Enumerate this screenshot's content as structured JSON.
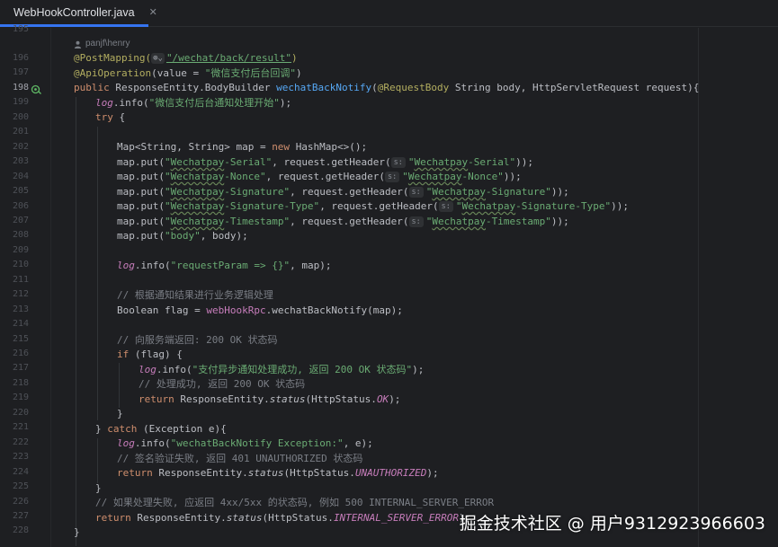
{
  "tab": {
    "label": "WebHookController.java",
    "close": "✕",
    "icon": "java-class-icon"
  },
  "author": "panjf\\henry",
  "gutter": {
    "first_partial": "195",
    "lines": [
      "196",
      "197",
      "198",
      "199",
      "200",
      "201",
      "202",
      "203",
      "204",
      "205",
      "206",
      "207",
      "208",
      "209",
      "210",
      "211",
      "212",
      "213",
      "214",
      "215",
      "216",
      "217",
      "218",
      "219",
      "220",
      "221",
      "222",
      "223",
      "224",
      "225",
      "226",
      "227",
      "228"
    ]
  },
  "code": {
    "l196": {
      "a": "@PostMapping(",
      "b": "\"/wechat/back/result\"",
      "c": ")"
    },
    "l197": {
      "a": "@ApiOperation",
      "b": "(value = ",
      "c": "\"微信支付后台回调\"",
      "d": ")"
    },
    "l198": {
      "a": "public ",
      "b": "ResponseEntity.BodyBuilder ",
      "c": "wechatBackNotify",
      "d": "(",
      "e": "@RequestBody ",
      "f": "String body, HttpServletRequest request){"
    },
    "l199": {
      "a": "log",
      "b": ".info(",
      "c": "\"微信支付后台通知处理开始\"",
      "d": ");"
    },
    "l200": {
      "a": "try",
      "b": " {"
    },
    "l202": {
      "a": "Map<String, String> map = ",
      "b": "new ",
      "c": "HashMap<>();"
    },
    "l203": {
      "a": "map.put(",
      "b": "\"",
      "c": "Wechatpay",
      "d": "-Serial\"",
      "e": ", request.getHeader(",
      "h": "s:",
      "f": "\"",
      "g": "Wechatpay",
      "i": "-Serial\"",
      "j": "));"
    },
    "l204": {
      "a": "map.put(",
      "b": "\"",
      "c": "Wechatpay",
      "d": "-Nonce\"",
      "e": ", request.getHeader(",
      "h": "s:",
      "f": "\"",
      "g": "Wechatpay",
      "i": "-Nonce\"",
      "j": "));"
    },
    "l205": {
      "a": "map.put(",
      "b": "\"",
      "c": "Wechatpay",
      "d": "-Signature\"",
      "e": ", request.getHeader(",
      "h": "s:",
      "f": "\"",
      "g": "Wechatpay",
      "i": "-Signature\"",
      "j": "));"
    },
    "l206": {
      "a": "map.put(",
      "b": "\"",
      "c": "Wechatpay",
      "d": "-Signature-Type\"",
      "e": ", request.getHeader(",
      "h": "s:",
      "f": "\"",
      "g": "Wechatpay",
      "i": "-Signature-Type\"",
      "j": "));"
    },
    "l207": {
      "a": "map.put(",
      "b": "\"",
      "c": "Wechatpay",
      "d": "-Timestamp\"",
      "e": ", request.getHeader(",
      "h": "s:",
      "f": "\"",
      "g": "Wechatpay",
      "i": "-Timestamp\"",
      "j": "));"
    },
    "l208": {
      "a": "map.put(",
      "b": "\"body\"",
      "c": ", body);"
    },
    "l210": {
      "a": "log",
      "b": ".info(",
      "c": "\"requestParam => {}\"",
      "d": ", map);"
    },
    "l212": {
      "a": "// 根据通知结果进行业务逻辑处理"
    },
    "l213": {
      "a": "Boolean flag = ",
      "b": "webHookRpc",
      "c": ".wechatBackNotify(map);"
    },
    "l215": {
      "a": "// 向服务端返回: 200 OK 状态码"
    },
    "l216": {
      "a": "if",
      "b": " (flag) {"
    },
    "l217": {
      "a": "log",
      "b": ".info(",
      "c": "\"支付异步通知处理成功, 返回 200 OK 状态码\"",
      "d": ");"
    },
    "l218": {
      "a": "// 处理成功, 返回 200 OK 状态码"
    },
    "l219": {
      "a": "return ",
      "b": "ResponseEntity.",
      "c": "status",
      "d": "(HttpStatus.",
      "e": "OK",
      "f": ");"
    },
    "l220": {
      "a": "}"
    },
    "l221": {
      "a": "} ",
      "b": "catch",
      "c": " (Exception e){"
    },
    "l222": {
      "a": "log",
      "b": ".info(",
      "c": "\"wechatBackNotify Exception:\"",
      "d": ", e);"
    },
    "l223": {
      "a": "// 签名验证失败, 返回 401 UNAUTHORIZED 状态码"
    },
    "l224": {
      "a": "return ",
      "b": "ResponseEntity.",
      "c": "status",
      "d": "(HttpStatus.",
      "e": "UNAUTHORIZED",
      "f": ");"
    },
    "l225": {
      "a": "}"
    },
    "l226": {
      "a": "// 如果处理失败, 应返回 4xx/5xx 的状态码, 例如 500 INTERNAL_SERVER_ERROR"
    },
    "l227": {
      "a": "return ",
      "b": "ResponseEntity.",
      "c": "status",
      "d": "(HttpStatus.",
      "e": "INTERNAL_SERVER_ERROR",
      "f": ");"
    },
    "l228": {
      "a": "}"
    }
  },
  "watermark": "掘金技术社区 @ 用户9312923966603",
  "colors": {
    "background": "#1e1f22",
    "annotation": "#b3ae60",
    "keyword": "#cf8e6d",
    "string": "#6aab73",
    "method": "#56a8f5",
    "field": "#c77dbb",
    "comment": "#7a7e85",
    "tab_underline": "#3574f0"
  }
}
